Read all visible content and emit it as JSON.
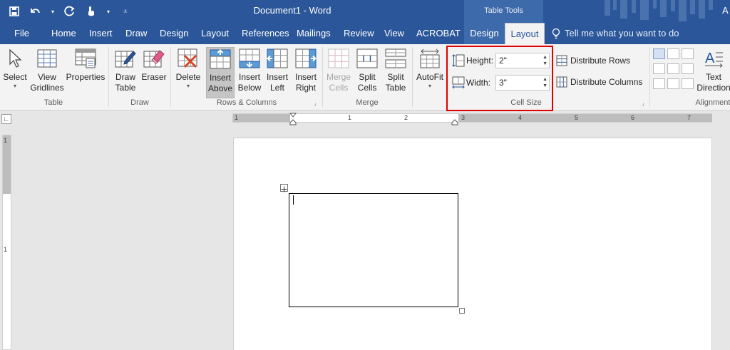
{
  "app": {
    "title": "Document1 - Word",
    "contextual_group": "Table Tools",
    "user_initial": "A"
  },
  "colors": {
    "brand": "#2b579a",
    "highlight": "#e00000"
  },
  "qat": {
    "icons": [
      "save-icon",
      "undo-icon",
      "redo-icon",
      "touch-mode-icon",
      "customize-icon"
    ]
  },
  "tabs": [
    {
      "label": "File"
    },
    {
      "label": "Home"
    },
    {
      "label": "Insert"
    },
    {
      "label": "Draw"
    },
    {
      "label": "Design"
    },
    {
      "label": "Layout"
    },
    {
      "label": "References"
    },
    {
      "label": "Mailings"
    },
    {
      "label": "Review"
    },
    {
      "label": "View"
    },
    {
      "label": "ACROBAT"
    },
    {
      "label": "Design"
    },
    {
      "label": "Layout"
    }
  ],
  "tell_me": {
    "placeholder": "Tell me what you want to do"
  },
  "ribbon": {
    "table": {
      "label": "Table",
      "select": "Select",
      "view_gridlines": "View\nGridlines",
      "properties": "Properties"
    },
    "draw": {
      "label": "Draw",
      "draw_table": "Draw\nTable",
      "eraser": "Eraser"
    },
    "rows_columns": {
      "label": "Rows & Columns",
      "delete": "Delete",
      "insert_above": "Insert\nAbove",
      "insert_below": "Insert\nBelow",
      "insert_left": "Insert\nLeft",
      "insert_right": "Insert\nRight"
    },
    "merge": {
      "label": "Merge",
      "merge_cells": "Merge\nCells",
      "split_cells": "Split\nCells",
      "split_table": "Split\nTable"
    },
    "autofit": {
      "label": "AutoFit"
    },
    "cell_size": {
      "label": "Cell Size",
      "height_label": "Height:",
      "height_value": "2\"",
      "width_label": "Width:",
      "width_value": "3\"",
      "distribute_rows": "Distribute Rows",
      "distribute_columns": "Distribute Columns"
    },
    "alignment": {
      "label": "Alignment",
      "text_direction": "Text\nDirection"
    }
  },
  "ruler": {
    "h_numbers": [
      "1",
      "1",
      "2",
      "3",
      "4",
      "5",
      "6",
      "7"
    ],
    "v_numbers": [
      "1",
      "1"
    ]
  }
}
